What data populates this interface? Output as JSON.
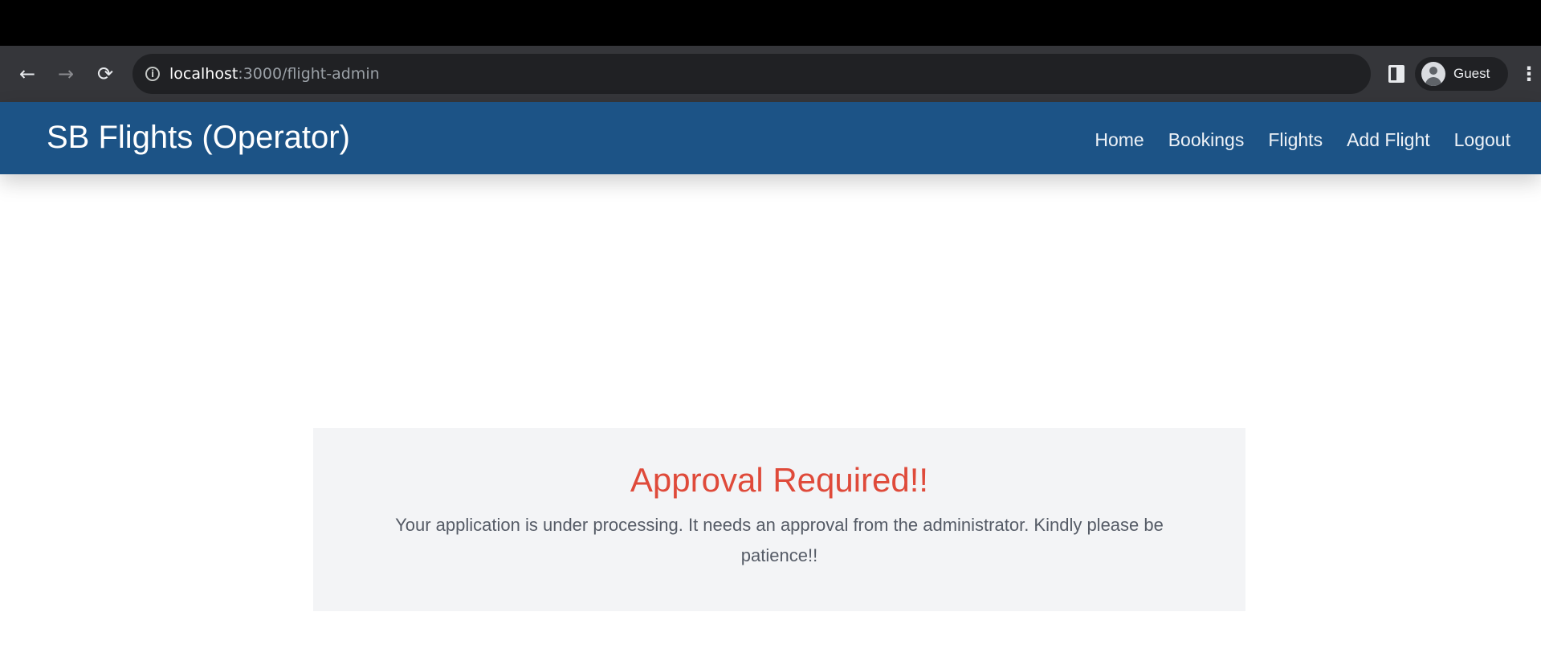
{
  "browser": {
    "url_host": "localhost",
    "url_rest": ":3000/flight-admin",
    "profile_label": "Guest",
    "icons": {
      "back": "arrow-left-icon",
      "forward": "arrow-right-icon",
      "reload": "reload-icon",
      "site_info": "info-icon",
      "side_panel": "side-panel-icon",
      "profile": "avatar-icon",
      "menu": "more-vertical-icon"
    }
  },
  "navbar": {
    "brand": "SB Flights (Operator)",
    "links": [
      "Home",
      "Bookings",
      "Flights",
      "Add Flight",
      "Logout"
    ],
    "background_color": "#1c5386"
  },
  "notice": {
    "title": "Approval Required!!",
    "message": "Your application is under processing. It needs an approval from the administrator. Kindly please be patience!!",
    "title_color": "#df4a3a"
  }
}
